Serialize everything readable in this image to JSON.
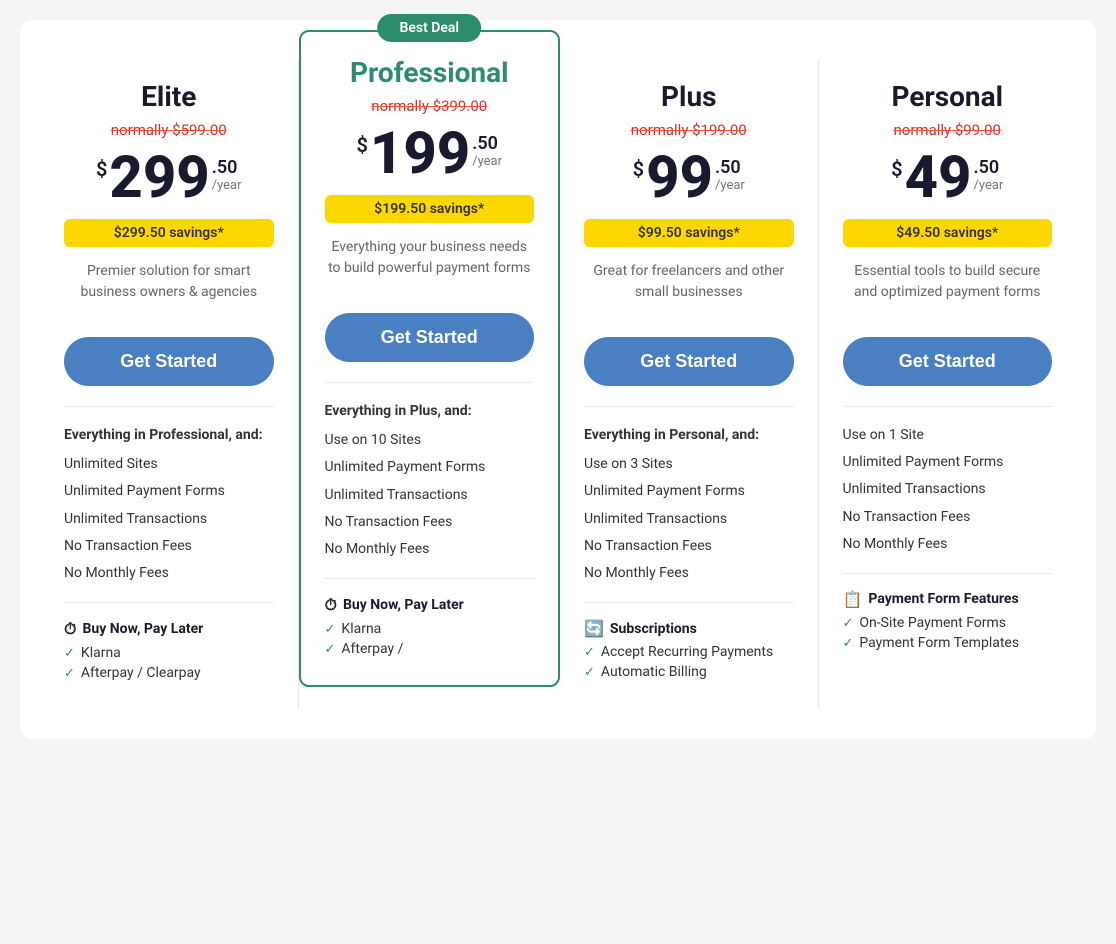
{
  "badge": "Best Deal",
  "plans": [
    {
      "id": "elite",
      "name": "Elite",
      "featured": false,
      "original_price": "normally $599.00",
      "price_main": "299",
      "price_cents": ".50",
      "price_year": "/year",
      "savings": "$299.50 savings*",
      "description": "Premier solution for smart business owners & agencies",
      "cta": "Get Started",
      "features_header": "Everything in Professional, and:",
      "features": [
        "Unlimited Sites",
        "Unlimited Payment Forms",
        "Unlimited Transactions",
        "No Transaction Fees",
        "No Monthly Fees"
      ],
      "section1_label": "Buy Now, Pay Later",
      "section1_icon": "⏱",
      "section1_items": [
        "Klarna",
        "Afterpay / Clearpay"
      ]
    },
    {
      "id": "professional",
      "name": "Professional",
      "featured": true,
      "original_price": "normally $399.00",
      "price_main": "199",
      "price_cents": ".50",
      "price_year": "/year",
      "savings": "$199.50 savings*",
      "description": "Everything your business needs to build powerful payment forms",
      "cta": "Get Started",
      "features_header": "Everything in Plus, and:",
      "features": [
        "Use on 10 Sites",
        "Unlimited Payment Forms",
        "Unlimited Transactions",
        "No Transaction Fees",
        "No Monthly Fees"
      ],
      "section1_label": "Buy Now, Pay Later",
      "section1_icon": "⏱",
      "section1_items": [
        "Klarna",
        "Afterpay /"
      ]
    },
    {
      "id": "plus",
      "name": "Plus",
      "featured": false,
      "original_price": "normally $199.00",
      "price_main": "99",
      "price_cents": ".50",
      "price_year": "/year",
      "savings": "$99.50 savings*",
      "description": "Great for freelancers and other small businesses",
      "cta": "Get Started",
      "features_header": "Everything in Personal, and:",
      "features": [
        "Use on 3 Sites",
        "Unlimited Payment Forms",
        "Unlimited Transactions",
        "No Transaction Fees",
        "No Monthly Fees"
      ],
      "section1_label": "Subscriptions",
      "section1_icon": "🔄",
      "section1_items": [
        "Accept Recurring Payments",
        "Automatic Billing"
      ]
    },
    {
      "id": "personal",
      "name": "Personal",
      "featured": false,
      "original_price": "normally $99.00",
      "price_main": "49",
      "price_cents": ".50",
      "price_year": "/year",
      "savings": "$49.50 savings*",
      "description": "Essential tools to build secure and optimized payment forms",
      "cta": "Get Started",
      "features_header": null,
      "features": [
        "Use on 1 Site",
        "Unlimited Payment Forms",
        "Unlimited Transactions",
        "No Transaction Fees",
        "No Monthly Fees"
      ],
      "section1_label": "Payment Form Features",
      "section1_icon": "📋",
      "section1_items": [
        "On-Site Payment Forms",
        "Payment Form Templates"
      ]
    }
  ]
}
